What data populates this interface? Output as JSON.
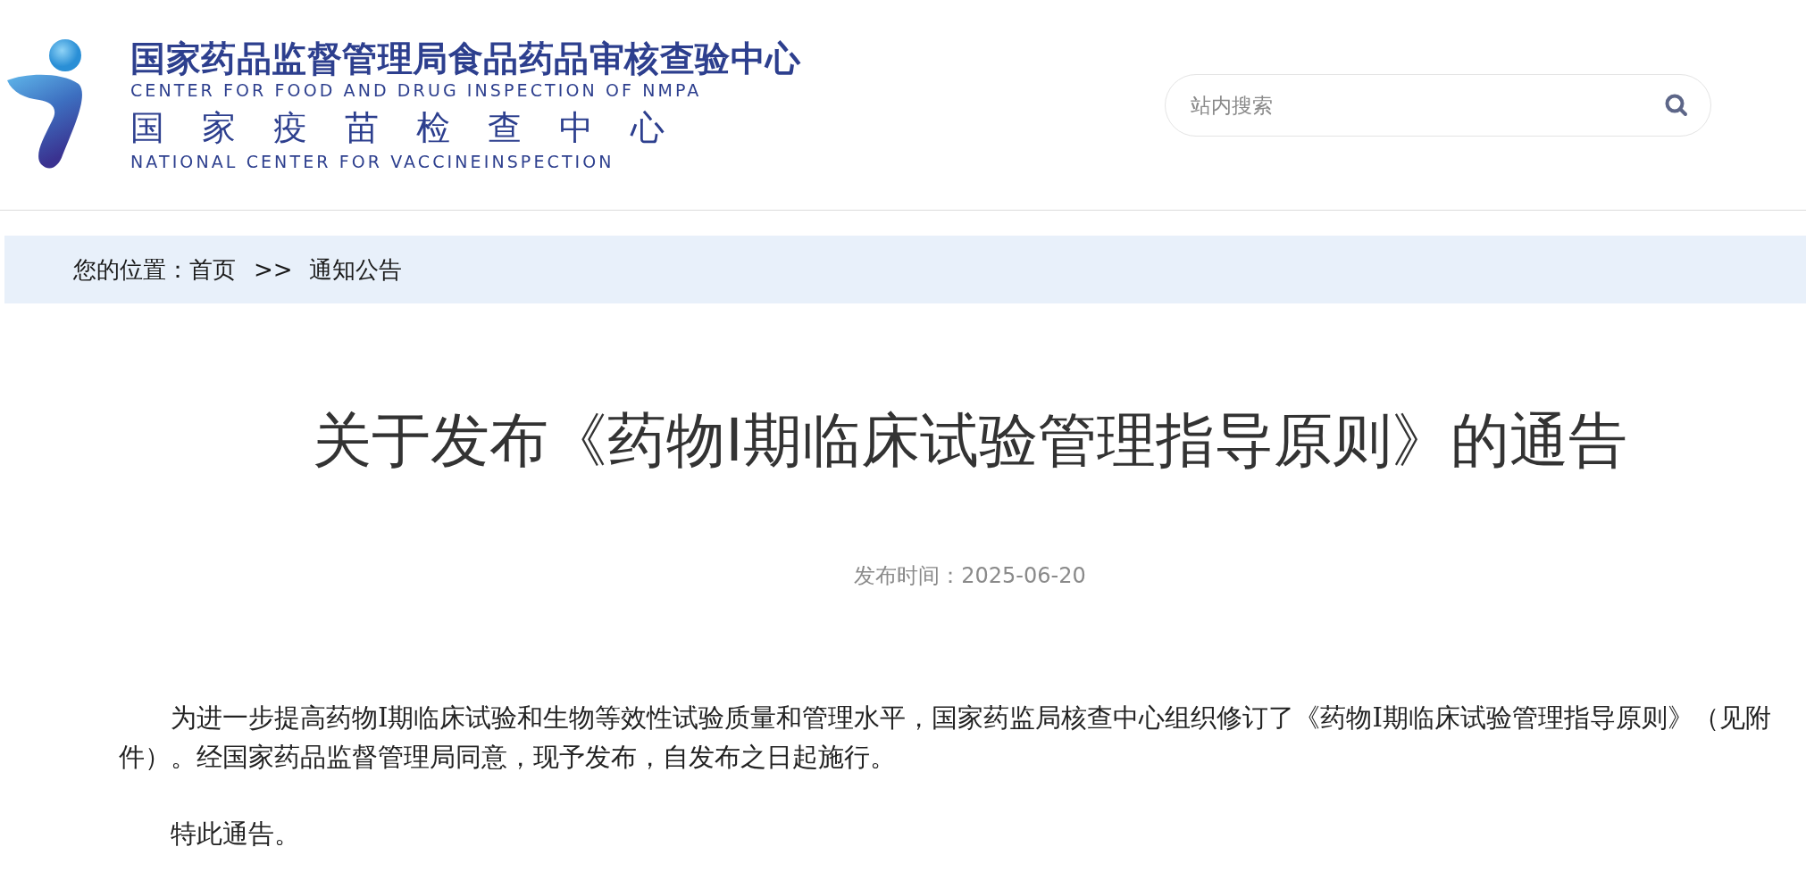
{
  "header": {
    "logo": {
      "name_cn": "国家药品监督管理局食品药品审核查验中心",
      "name_en": "CENTER FOR FOOD AND DRUG INSPECTION OF NMPA",
      "name2_cn": "国家疫苗检查中心",
      "name2_en": "NATIONAL CENTER FOR VACCINEINSPECTION"
    },
    "search": {
      "placeholder": "站内搜索"
    }
  },
  "breadcrumb": {
    "label": "您的位置：",
    "items": [
      {
        "text": "首页",
        "kind": "link"
      },
      {
        "text": ">>",
        "kind": "separator"
      },
      {
        "text": "通知公告",
        "kind": "link"
      }
    ]
  },
  "article": {
    "title": "关于发布《药物Ⅰ期临床试验管理指导原则》的通告",
    "date": "发布时间：2025-06-20",
    "paragraphs": [
      "为进一步提高药物Ⅰ期临床试验和生物等效性试验质量和管理水平，国家药监局核查中心组织修订了《药物Ⅰ期临床试验管理指导原则》（见附件）。经国家药品监督管理局同意，现予发布，自发布之日起施行。",
      "特此通告。"
    ]
  }
}
